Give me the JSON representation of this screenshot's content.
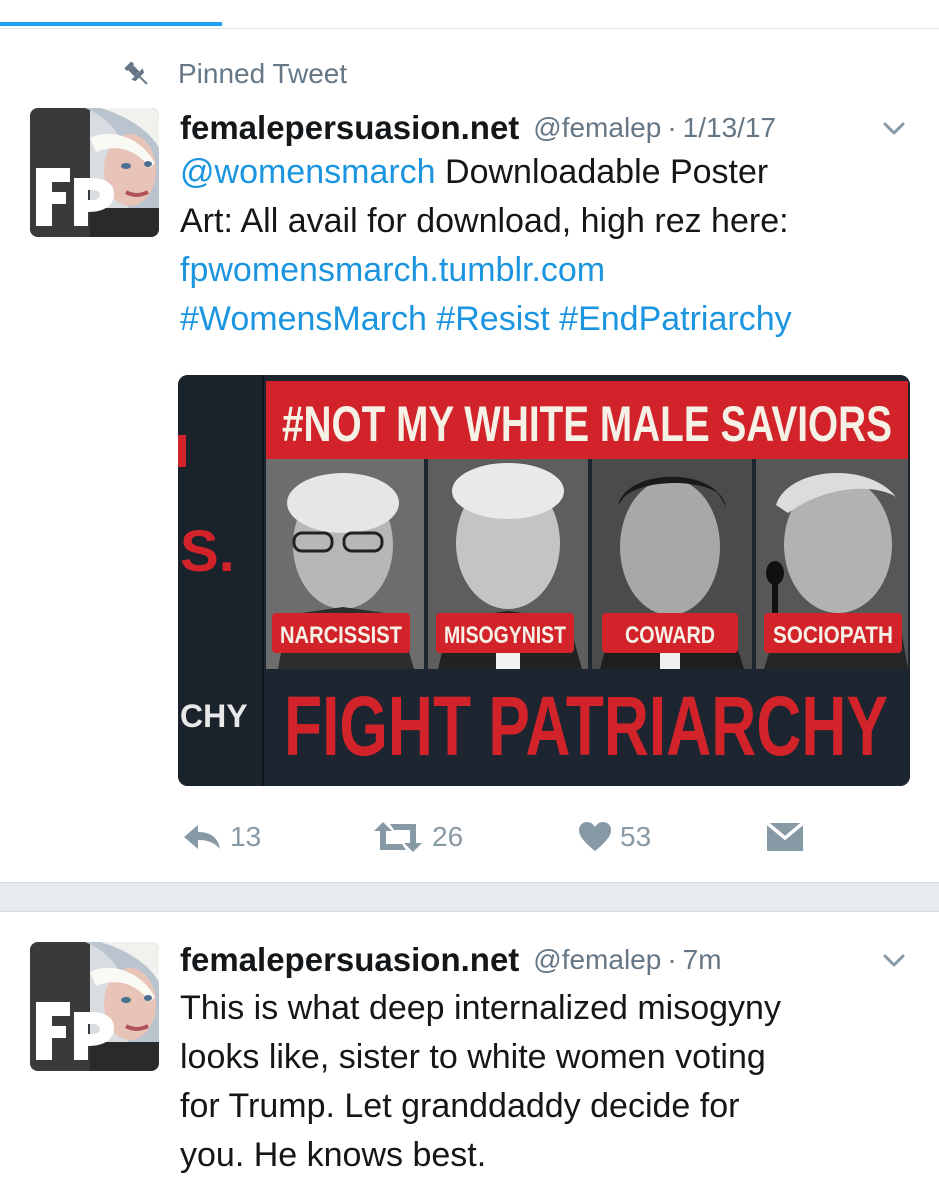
{
  "colors": {
    "accent": "#1da1f2",
    "link": "#1b95e0",
    "muted": "#657786",
    "poster_red": "#d2232a"
  },
  "pinned": {
    "label": "Pinned Tweet",
    "icon": "pin-icon"
  },
  "tweets": [
    {
      "author": {
        "name": "femalepersuasion.net",
        "handle": "@femalep",
        "avatar_monogram": "FP"
      },
      "time": "1/13/17",
      "text": {
        "mention": "@womensmarch",
        "line1": " Downloadable Poster",
        "line2": "Art: All avail for download, high rez here:",
        "url": "fpwomensmarch.tumblr.com",
        "hashtags": "#WomensMarch #Resist #EndPatriarchy"
      },
      "media": {
        "headline": "#NOT MY WHITE MALE SAVIORS",
        "left_fragment_a": "S.",
        "left_fragment_b": "CHY",
        "labels": [
          "NARCISSIST",
          "MISOGYNIST",
          "COWARD",
          "SOCIOPATH"
        ],
        "slogan": "FIGHT PATRIARCHY"
      },
      "actions": {
        "replies": "13",
        "retweets": "26",
        "likes": "53"
      }
    },
    {
      "author": {
        "name": "femalepersuasion.net",
        "handle": "@femalep",
        "avatar_monogram": "FP"
      },
      "time": "7m",
      "text": {
        "line1": "This is what deep internalized misogyny",
        "line2": "looks like, sister to white women voting",
        "line3": "for Trump. Let granddaddy decide for",
        "line4": "you. He knows best."
      }
    }
  ]
}
